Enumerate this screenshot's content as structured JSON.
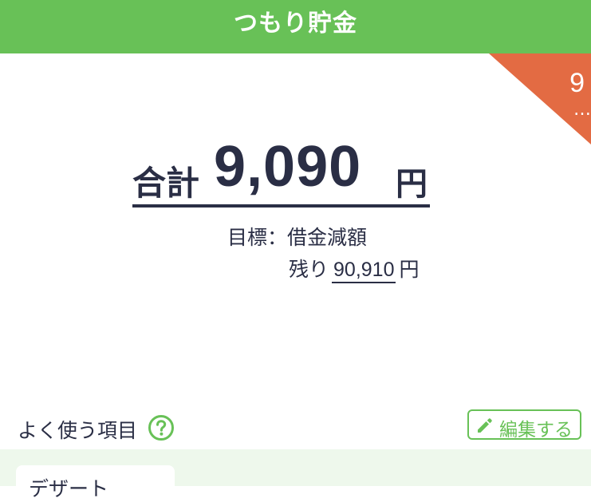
{
  "header": {
    "title": "つもり貯金"
  },
  "corner_badge": {
    "count": "9",
    "more": "…",
    "color": "#e36b43"
  },
  "summary": {
    "total_label": "合計",
    "total_amount": "9,090",
    "total_unit": "円",
    "goal_text": "目標：借金減額",
    "remaining_label": "残り",
    "remaining_amount": "90,910",
    "remaining_unit": "円"
  },
  "frequent": {
    "title": "よく使う項目",
    "edit_label": "編集する",
    "items": [
      {
        "label": "デザート"
      }
    ]
  },
  "colors": {
    "brand_green": "#68c157",
    "text_dark": "#2a2e45",
    "area_bg": "#eef8ec"
  }
}
